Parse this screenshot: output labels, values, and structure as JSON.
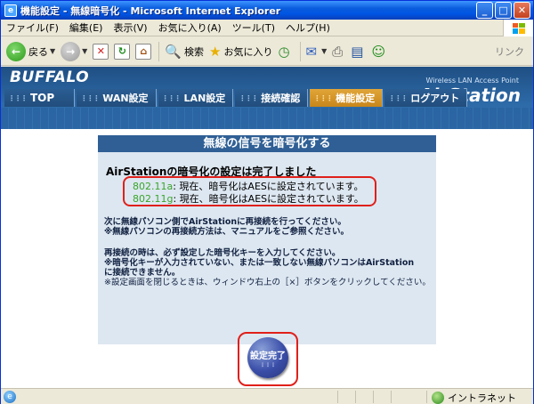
{
  "window": {
    "title": "機能設定 - 無線暗号化 - Microsoft Internet Explorer"
  },
  "menubar": {
    "items": [
      "ファイル(F)",
      "編集(E)",
      "表示(V)",
      "お気に入り(A)",
      "ツール(T)",
      "ヘルプ(H)"
    ]
  },
  "toolbar": {
    "back_label": "戻る",
    "search_label": "検索",
    "favorites_label": "お気に入り",
    "links_label": "リンク"
  },
  "header": {
    "brand": "BUFFALO",
    "product_sub": "Wireless LAN Access Point",
    "product_name": "AirStation"
  },
  "nav": {
    "items": [
      "TOP",
      "WAN設定",
      "LAN設定",
      "接続確認",
      "機能設定",
      "ログアウト"
    ],
    "active": "機能設定"
  },
  "panel": {
    "title": "無線の信号を暗号化する",
    "status": "AirStationの暗号化の設定は完了しました",
    "results": [
      {
        "band": "802.11a",
        "text": ": 現在、暗号化はAESに設定されています。"
      },
      {
        "band": "802.11g",
        "text": ": 現在、暗号化はAESに設定されています。"
      }
    ],
    "note1": [
      "次に無線パソコン側でAirStationに再接続を行ってください。",
      "※無線パソコンの再接続方法は、マニュアルをご参照ください。"
    ],
    "note2": [
      "再接続の時は、必ず設定した暗号化キーを入力してください。",
      "※暗号化キーが入力されていない、または一致しない無線パソコンはAirStation",
      "に接続できません。",
      "※設定画面を閉じるときは、ウィンドウ右上の［×］ボタンをクリックしてください。"
    ],
    "finish_button": "設定完了"
  },
  "statusbar": {
    "zone": "イントラネット"
  }
}
